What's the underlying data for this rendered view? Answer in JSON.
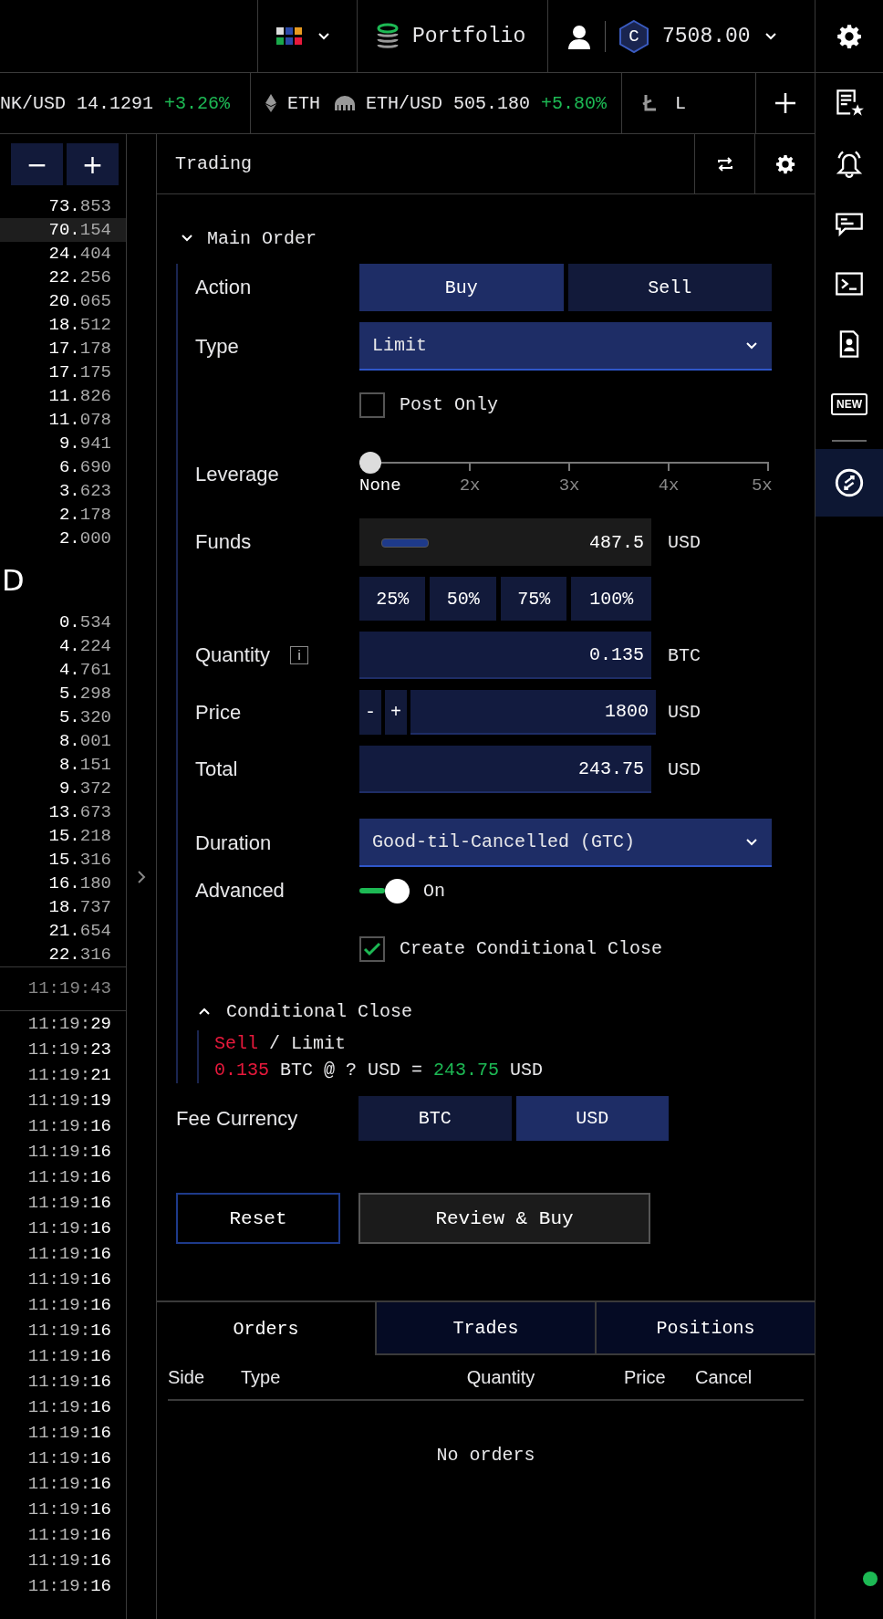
{
  "topbar": {
    "portfolio": "Portfolio",
    "coin_symbol": "C",
    "balance": "7508.00"
  },
  "ticker": [
    {
      "kind": "pair",
      "symbol": "NK/USD",
      "price": "14.1291",
      "change": "+3.26%",
      "divider_after": true
    },
    {
      "kind": "asset",
      "symbol": "ETH",
      "divider_after": false
    },
    {
      "kind": "pair",
      "symbol": "ETH/USD",
      "price": "505.180",
      "change": "+5.80%",
      "divider_after": true
    },
    {
      "kind": "asset",
      "symbol": "L",
      "divider_after": false
    }
  ],
  "order_book": {
    "decrease": "−",
    "increase": "+",
    "asks": [
      {
        "value": "73.853",
        "highlighted": false
      },
      {
        "value": "70.154",
        "highlighted": true
      },
      {
        "value": "24.404",
        "highlighted": false
      },
      {
        "value": "22.256",
        "highlighted": false
      },
      {
        "value": "20.065",
        "highlighted": false
      },
      {
        "value": "18.512",
        "highlighted": false
      },
      {
        "value": "17.178",
        "highlighted": false
      },
      {
        "value": "17.175",
        "highlighted": false
      },
      {
        "value": "11.826",
        "highlighted": false
      },
      {
        "value": "11.078",
        "highlighted": false
      },
      {
        "value": "9.941",
        "highlighted": false
      },
      {
        "value": "6.690",
        "highlighted": false
      },
      {
        "value": "3.623",
        "highlighted": false
      },
      {
        "value": "2.178",
        "highlighted": false
      },
      {
        "value": "2.000",
        "highlighted": false
      }
    ],
    "spread": "D",
    "bids": [
      {
        "value": "0.534",
        "highlighted": false
      },
      {
        "value": "4.224",
        "highlighted": false
      },
      {
        "value": "4.761",
        "highlighted": false
      },
      {
        "value": "5.298",
        "highlighted": false
      },
      {
        "value": "5.320",
        "highlighted": false
      },
      {
        "value": "8.001",
        "highlighted": false
      },
      {
        "value": "8.151",
        "highlighted": false
      },
      {
        "value": "9.372",
        "highlighted": false
      },
      {
        "value": "13.673",
        "highlighted": false
      },
      {
        "value": "15.218",
        "highlighted": false
      },
      {
        "value": "15.316",
        "highlighted": false
      },
      {
        "value": "16.180",
        "highlighted": false
      },
      {
        "value": "18.737",
        "highlighted": false
      },
      {
        "value": "21.654",
        "highlighted": false
      },
      {
        "value": "22.316",
        "highlighted": false
      }
    ],
    "clock": "11:19:43",
    "trade_times": [
      "11:19:29",
      "11:19:23",
      "11:19:21",
      "11:19:19",
      "11:19:16",
      "11:19:16",
      "11:19:16",
      "11:19:16",
      "11:19:16",
      "11:19:16",
      "11:19:16",
      "11:19:16",
      "11:19:16",
      "11:19:16",
      "11:19:16",
      "11:19:16",
      "11:19:16",
      "11:19:16",
      "11:19:16",
      "11:19:16",
      "11:19:16",
      "11:19:16",
      "11:19:16"
    ]
  },
  "trading": {
    "title": "Trading",
    "main_order": {
      "title": "Main Order",
      "expanded": true
    },
    "action": {
      "label": "Action",
      "options": [
        {
          "label": "Buy",
          "selected": true
        },
        {
          "label": "Sell",
          "selected": false
        }
      ]
    },
    "type": {
      "label": "Type",
      "value": "Limit"
    },
    "post_only": {
      "label": "Post Only",
      "checked": false
    },
    "leverage": {
      "label": "Leverage",
      "level": 0,
      "ticks": [
        {
          "label": "None",
          "selected": true
        },
        {
          "label": "2x",
          "selected": false
        },
        {
          "label": "3x",
          "selected": false
        },
        {
          "label": "4x",
          "selected": false
        },
        {
          "label": "5x",
          "selected": false
        }
      ]
    },
    "funds": {
      "label": "Funds",
      "value": "487.5",
      "unit": "USD",
      "presets": [
        "25%",
        "50%",
        "75%",
        "100%"
      ]
    },
    "quantity": {
      "label": "Quantity",
      "info": "i",
      "value": "0.135",
      "unit": "BTC"
    },
    "price": {
      "label": "Price",
      "decrease": "-",
      "increase": "+",
      "value": "1800",
      "unit": "USD"
    },
    "total": {
      "label": "Total",
      "value": "243.75",
      "unit": "USD"
    },
    "duration": {
      "label": "Duration",
      "value": "Good-til-Cancelled (GTC)"
    },
    "advanced": {
      "label": "Advanced",
      "on": true,
      "state": "On"
    },
    "conditional_close_option": {
      "label": "Create Conditional Close",
      "checked": true
    },
    "conditional_close": {
      "title": "Conditional Close",
      "expanded": true,
      "side": "Sell",
      "separator": "/",
      "order_type": "Limit",
      "quantity": "0.135",
      "rest": "BTC @ ? USD =",
      "amount": "243.75",
      "currency": "USD"
    },
    "fee_currency": {
      "label": "Fee Currency",
      "options": [
        {
          "label": "BTC",
          "selected": false
        },
        {
          "label": "USD",
          "selected": true
        }
      ]
    },
    "reset": "Reset",
    "submit": "Review & Buy"
  },
  "orders_panel": {
    "tabs": [
      {
        "label": "Orders",
        "selected": true
      },
      {
        "label": "Trades",
        "selected": false
      },
      {
        "label": "Positions",
        "selected": false
      }
    ],
    "columns": [
      "Side",
      "Type",
      "Quantity",
      "Price",
      "Cancel"
    ],
    "empty": "No orders"
  },
  "sidebar": {
    "items": [
      {
        "kind": "watchlist",
        "selected": false
      },
      {
        "kind": "alerts",
        "selected": false
      },
      {
        "kind": "chat",
        "selected": false
      },
      {
        "kind": "console",
        "selected": false
      },
      {
        "kind": "contact",
        "selected": false
      },
      {
        "kind": "new",
        "text": "NEW",
        "selected": false
      },
      {
        "kind": "swap",
        "selected": true
      }
    ],
    "connected": true
  }
}
